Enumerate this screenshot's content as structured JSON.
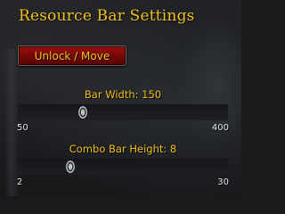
{
  "header": {
    "title": "Resource Bar Settings"
  },
  "unlock_button": {
    "label": "Unlock / Move"
  },
  "sliders": [
    {
      "label": "Bar Width: 150",
      "min": 50,
      "max": 400,
      "min_label": "50",
      "max_label": "400",
      "value": 150
    },
    {
      "label": "Combo Bar Height: 8",
      "min": 2,
      "max": 30,
      "min_label": "2",
      "max_label": "30",
      "value": 8
    }
  ],
  "colors": {
    "accent_gold": "#f2c21c",
    "button_red": "#8a0b08",
    "track": "#1a1b1f"
  },
  "icons": {
    "slider_thumb": "slider-thumb-icon"
  }
}
